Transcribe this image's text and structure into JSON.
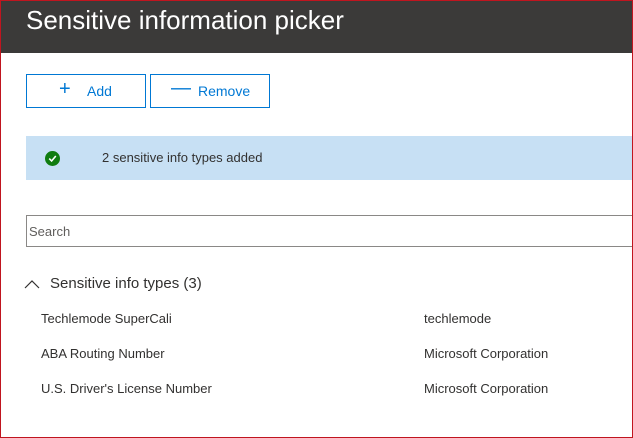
{
  "header": {
    "title": "Sensitive information picker"
  },
  "toolbar": {
    "add_label": "Add",
    "remove_label": "Remove",
    "add_icon": "plus-icon",
    "remove_icon": "minus-icon"
  },
  "banner": {
    "text": "2 sensitive info types added",
    "icon": "check-circle-icon",
    "background": "#c7e0f4",
    "icon_color": "#107c10"
  },
  "search": {
    "placeholder": "Search",
    "value": ""
  },
  "group": {
    "label": "Sensitive info types (3)",
    "icon": "chevron-up-icon",
    "items": [
      {
        "name": "Techlemode SuperCali",
        "publisher": "techlemode"
      },
      {
        "name": "ABA Routing Number",
        "publisher": "Microsoft Corporation"
      },
      {
        "name": "U.S. Driver's License Number",
        "publisher": "Microsoft Corporation"
      }
    ]
  },
  "colors": {
    "title_bar": "#3b3a39",
    "accent": "#0078d4",
    "frame_border": "#c0151f"
  }
}
